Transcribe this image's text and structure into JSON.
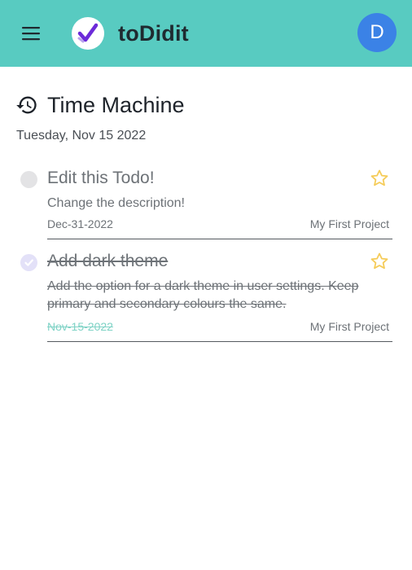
{
  "header": {
    "app_name": "toDidit",
    "avatar_initial": "D",
    "accent_color": "#58cbc1",
    "avatar_color": "#3b82e6"
  },
  "page": {
    "title": "Time Machine",
    "date": "Tuesday, Nov 15 2022"
  },
  "todos": [
    {
      "title": "Edit this Todo!",
      "description": "Change the description!",
      "due": "Dec-31-2022",
      "project": "My First Project",
      "completed": false,
      "starred": false
    },
    {
      "title": "Add dark theme",
      "description": "Add the option for a dark theme in user settings. Keep primary and secondary colours the same.",
      "due": "Nov-15-2022",
      "project": "My First Project",
      "completed": true,
      "starred": false
    }
  ]
}
